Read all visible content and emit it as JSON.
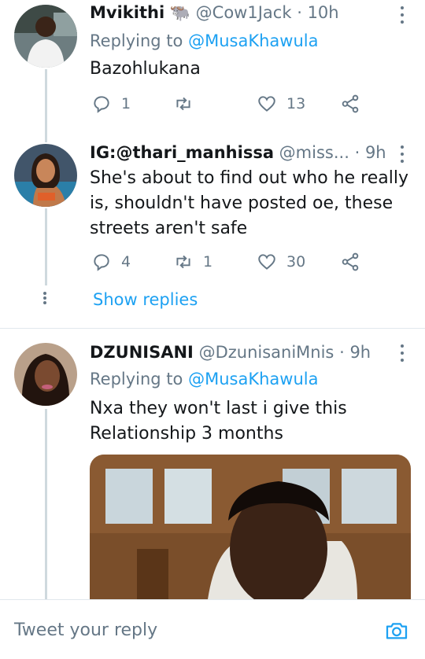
{
  "colors": {
    "accent": "#1da1f2",
    "secondary_text": "#657786",
    "primary_text": "#14171a",
    "divider": "#e1e8ed"
  },
  "tweets": [
    {
      "name": "Mvikithi",
      "name_emoji": "🐃",
      "handle": "@Cow1Jack",
      "dot": "·",
      "time": "10h",
      "replying_prefix": "Replying to",
      "replying_to": "@MusaKhawula",
      "text": "Bazohlukana",
      "replies": "1",
      "retweets": "",
      "likes": "13"
    },
    {
      "name": "IG:@thari_manhissa",
      "handle": "@miss...",
      "dot": "·",
      "time": "9h",
      "text": "She's about to find out who he really is, shouldn't have posted oe, these streets aren't safe",
      "replies": "4",
      "retweets": "1",
      "likes": "30",
      "show_replies": "Show replies"
    },
    {
      "name": "DZUNISANI",
      "handle": "@DzunisaniMnis",
      "dot": "·",
      "time": "9h",
      "replying_prefix": "Replying to",
      "replying_to": "@MusaKhawula",
      "text": "Nxa they won't last i give this Relationship 3 months"
    }
  ],
  "composer": {
    "placeholder": "Tweet your reply"
  },
  "icons": [
    "reply-icon",
    "retweet-icon",
    "like-icon",
    "share-icon",
    "more-icon",
    "camera-icon"
  ]
}
